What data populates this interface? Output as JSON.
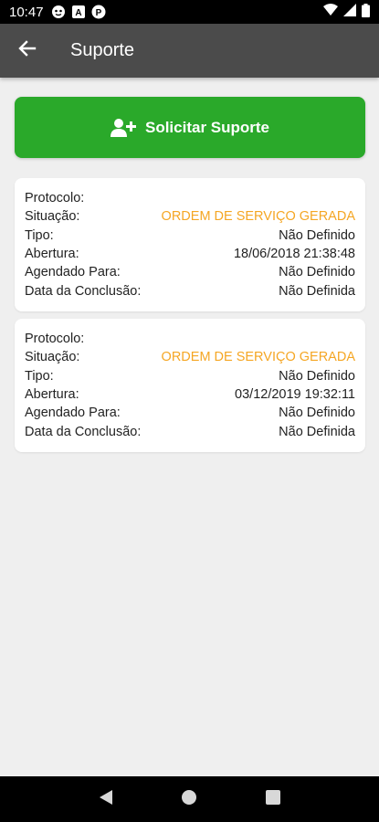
{
  "status_bar": {
    "time": "10:47",
    "icons": [
      "notification-icon",
      "a-icon",
      "p-icon"
    ],
    "right_icons": [
      "wifi-icon",
      "signal-icon",
      "battery-icon"
    ]
  },
  "app_bar": {
    "title": "Suporte",
    "back_icon": "arrow-left-icon"
  },
  "request_button": {
    "label": "Solicitar Suporte",
    "icon": "add-user-icon",
    "color": "#2aa92a"
  },
  "status_color": "#f5a623",
  "tickets": [
    {
      "rows": [
        {
          "label": "Protocolo:",
          "value": ""
        },
        {
          "label": "Situação:",
          "value": "ORDEM DE SERVIÇO GERADA"
        },
        {
          "label": "Tipo:",
          "value": "Não Definido"
        },
        {
          "label": "Abertura:",
          "value": "18/06/2018 21:38:48"
        },
        {
          "label": "Agendado Para:",
          "value": "Não Definido"
        },
        {
          "label": "Data da Conclusão:",
          "value": "Não Definida"
        }
      ]
    },
    {
      "rows": [
        {
          "label": "Protocolo:",
          "value": ""
        },
        {
          "label": "Situação:",
          "value": "ORDEM DE SERVIÇO GERADA"
        },
        {
          "label": "Tipo:",
          "value": "Não Definido"
        },
        {
          "label": "Abertura:",
          "value": "03/12/2019 19:32:11"
        },
        {
          "label": "Agendado Para:",
          "value": "Não Definido"
        },
        {
          "label": "Data da Conclusão:",
          "value": "Não Definida"
        }
      ]
    }
  ],
  "nav_bar": {
    "buttons": [
      "back-triangle-icon",
      "home-circle-icon",
      "recents-square-icon"
    ]
  }
}
